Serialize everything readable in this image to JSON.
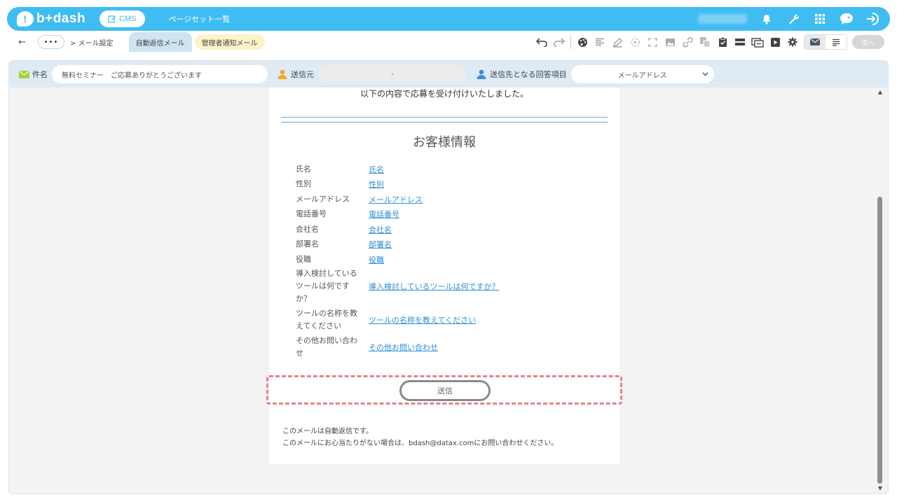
{
  "header": {
    "logo_text": "b+dash",
    "cms_label": "CMS",
    "page_set_label": "ページセット一覧"
  },
  "toolbar": {
    "back_icon": "←",
    "more_label": "•••",
    "breadcrumb": "> メール設定",
    "tab_auto_reply": "自動返信メール",
    "tab_admin_notify": "管理者通知メール",
    "next_label": "次へ"
  },
  "fields": {
    "subject_label": "件名",
    "subject_value": "無料セミナー　ご応募ありがとうございます",
    "sender_label": "送信元",
    "sender_value": "-",
    "recipient_label": "送信先となる回答項目",
    "recipient_value": "メールアドレス"
  },
  "mail": {
    "intro": "以下の内容で応募を受け付けいたしました。",
    "section_title": "お客様情報",
    "rows": [
      {
        "key": "氏名",
        "value": "氏名"
      },
      {
        "key": "性別",
        "value": "性別"
      },
      {
        "key": "メールアドレス",
        "value": "メールアドレス"
      },
      {
        "key": "電話番号",
        "value": "電話番号"
      },
      {
        "key": "会社名",
        "value": "会社名"
      },
      {
        "key": "部署名",
        "value": "部署名"
      },
      {
        "key": "役職",
        "value": "役職"
      },
      {
        "key": "導入検討しているツールは何ですか？",
        "value": "導入検討しているツールは何ですか？"
      },
      {
        "key": "ツールの名称を教えてください",
        "value": "ツールの名称を教えてください"
      },
      {
        "key": "その他お問い合わせ",
        "value": "その他お問い合わせ"
      }
    ],
    "submit_label": "送信",
    "footer_line1": "このメールは自動返信です。",
    "footer_line2": "このメールにお心当たりがない場合は、bdash@datax.comにお問い合わせください。"
  },
  "colors": {
    "brand": "#3fbdf2",
    "link": "#2f8ed8",
    "highlight": "#ee7f8c"
  }
}
